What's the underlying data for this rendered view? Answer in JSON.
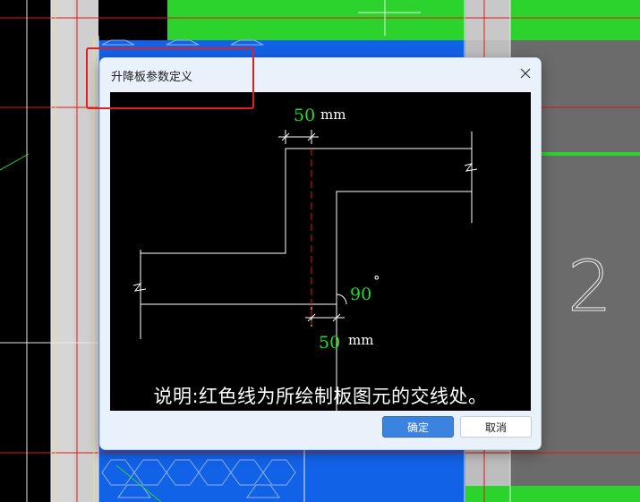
{
  "dialog": {
    "title": "升降板参数定义",
    "close_icon": "close-icon",
    "preview": {
      "dim_top_value": "50",
      "dim_top_unit": "mm",
      "dim_bottom_value": "50",
      "dim_bottom_unit": "mm",
      "angle_value": "90",
      "angle_unit": "°",
      "caption": "说明:红色线为所绘制板图元的交线处。"
    },
    "ok_label": "确定",
    "cancel_label": "取消"
  },
  "background": {
    "page_number": "2"
  },
  "colors": {
    "green_fill": "#2cd32c",
    "blue_fill": "#1262e8",
    "gray_fill": "#6b6b6b",
    "red_line": "#e01818",
    "accent_button": "#3b83e0",
    "dim_text_green": "#22dd22"
  }
}
